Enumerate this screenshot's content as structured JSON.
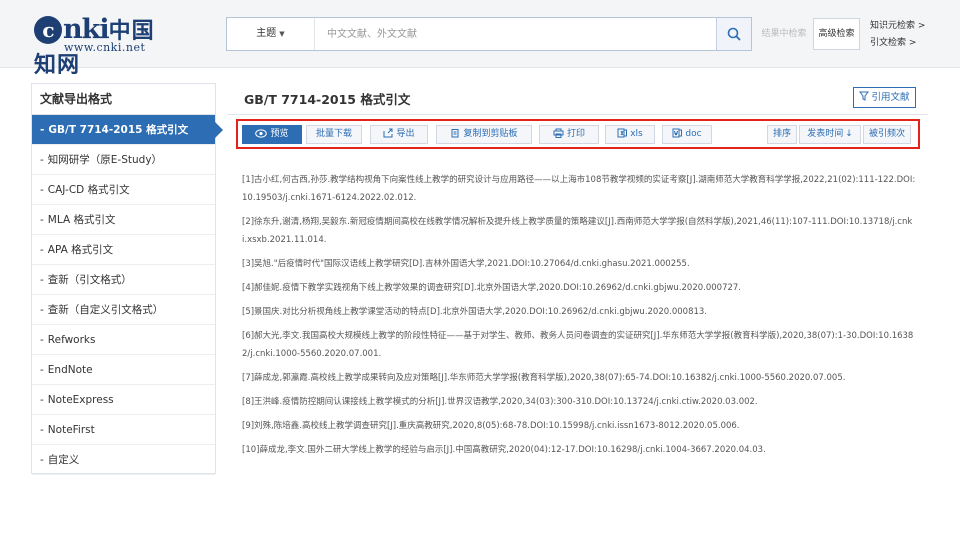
{
  "header": {
    "logo_text": "cnki中国知网",
    "logo_url": "www.cnki.net",
    "search_scope": "主题",
    "search_placeholder": "中文文献、外文文献",
    "result_search_label": "结果中检索",
    "advanced_search_label": "高级检索",
    "links": [
      "知识元检索 >",
      "引文检索 >"
    ]
  },
  "sidebar": {
    "title": "文献导出格式",
    "items": [
      {
        "label": "GB/T 7714-2015 格式引文",
        "active": true
      },
      {
        "label": "知网研学（原E-Study）",
        "active": false
      },
      {
        "label": "CAJ-CD 格式引文",
        "active": false
      },
      {
        "label": "MLA 格式引文",
        "active": false
      },
      {
        "label": "APA 格式引文",
        "active": false
      },
      {
        "label": "查新（引文格式）",
        "active": false
      },
      {
        "label": "查新（自定义引文格式）",
        "active": false
      },
      {
        "label": "Refworks",
        "active": false
      },
      {
        "label": "EndNote",
        "active": false
      },
      {
        "label": "NoteExpress",
        "active": false
      },
      {
        "label": "NoteFirst",
        "active": false
      },
      {
        "label": "自定义",
        "active": false
      }
    ]
  },
  "main": {
    "title": "GB/T 7714-2015 格式引文",
    "cite_button": "引用文献",
    "toolbar": {
      "preview": "预览",
      "batch_download": "批量下载",
      "export": "导出",
      "copy_to_clipboard": "复制到剪贴板",
      "print": "打印",
      "xls": "xls",
      "doc": "doc",
      "sort": "排序",
      "publish_time": "发表时间",
      "cited_count": "被引频次"
    },
    "references": [
      "[1]古小红,何古西,孙莎.教学结构视角下向案性线上教学的研究设计与应用路径——以上海市108节教学视频的实证考察[J].湖南师范大学教育科学学报,2022,21(02):111-122.DOI:10.19503/j.cnki.1671-6124.2022.02.012.",
      "[2]徐东升,谢清,杨翔,吴毅东.新冠疫情期间高校在线教学情况解析及提升线上教学质量的策略建议[J].西南师范大学学报(自然科学版),2021,46(11):107-111.DOI:10.13718/j.cnki.xsxb.2021.11.014.",
      "[3]吴旭.\"后疫情时代\"国际汉语线上教学研究[D].吉林外国语大学,2021.DOI:10.27064/d.cnki.ghasu.2021.000255.",
      "[4]郝佳妮.疫情下教学实践视角下线上教学效果的调查研究[D].北京外国语大学,2020.DOI:10.26962/d.cnki.gbjwu.2020.000727.",
      "[5]景国庆.对比分析视角线上教学课堂活动的特点[D].北京外国语大学,2020.DOI:10.26962/d.cnki.gbjwu.2020.000813.",
      "[6]郝大光,李文.我国高校大规模线上教学的阶段性特征——基于对学生、教师、教务人员问卷调查的实证研究[J].华东师范大学学报(教育科学版),2020,38(07):1-30.DOI:10.16382/j.cnki.1000-5560.2020.07.001.",
      "[7]薛成龙,郭瀛霞.高校线上教学成果转向及应对策略[J].华东师范大学学报(教育科学版),2020,38(07):65-74.DOI:10.16382/j.cnki.1000-5560.2020.07.005.",
      "[8]王洪峰.疫情防控期间认课接线上教学模式的分析[J].世界汉语教学,2020,34(03):300-310.DOI:10.13724/j.cnki.ctiw.2020.03.002.",
      "[9]刘殊,陈培鑫.高校线上教学调查研究[J].重庆高教研究,2020,8(05):68-78.DOI:10.15998/j.cnki.issn1673-8012.2020.05.006.",
      "[10]薛成龙,李文.国外二研大学线上教学的经验与启示[J].中国高教研究,2020(04):12-17.DOI:10.16298/j.cnki.1004-3667.2020.04.03."
    ]
  },
  "colors": {
    "accent": "#2c6db3",
    "highlight_border": "#e2231a",
    "logo": "#1d3f73"
  }
}
